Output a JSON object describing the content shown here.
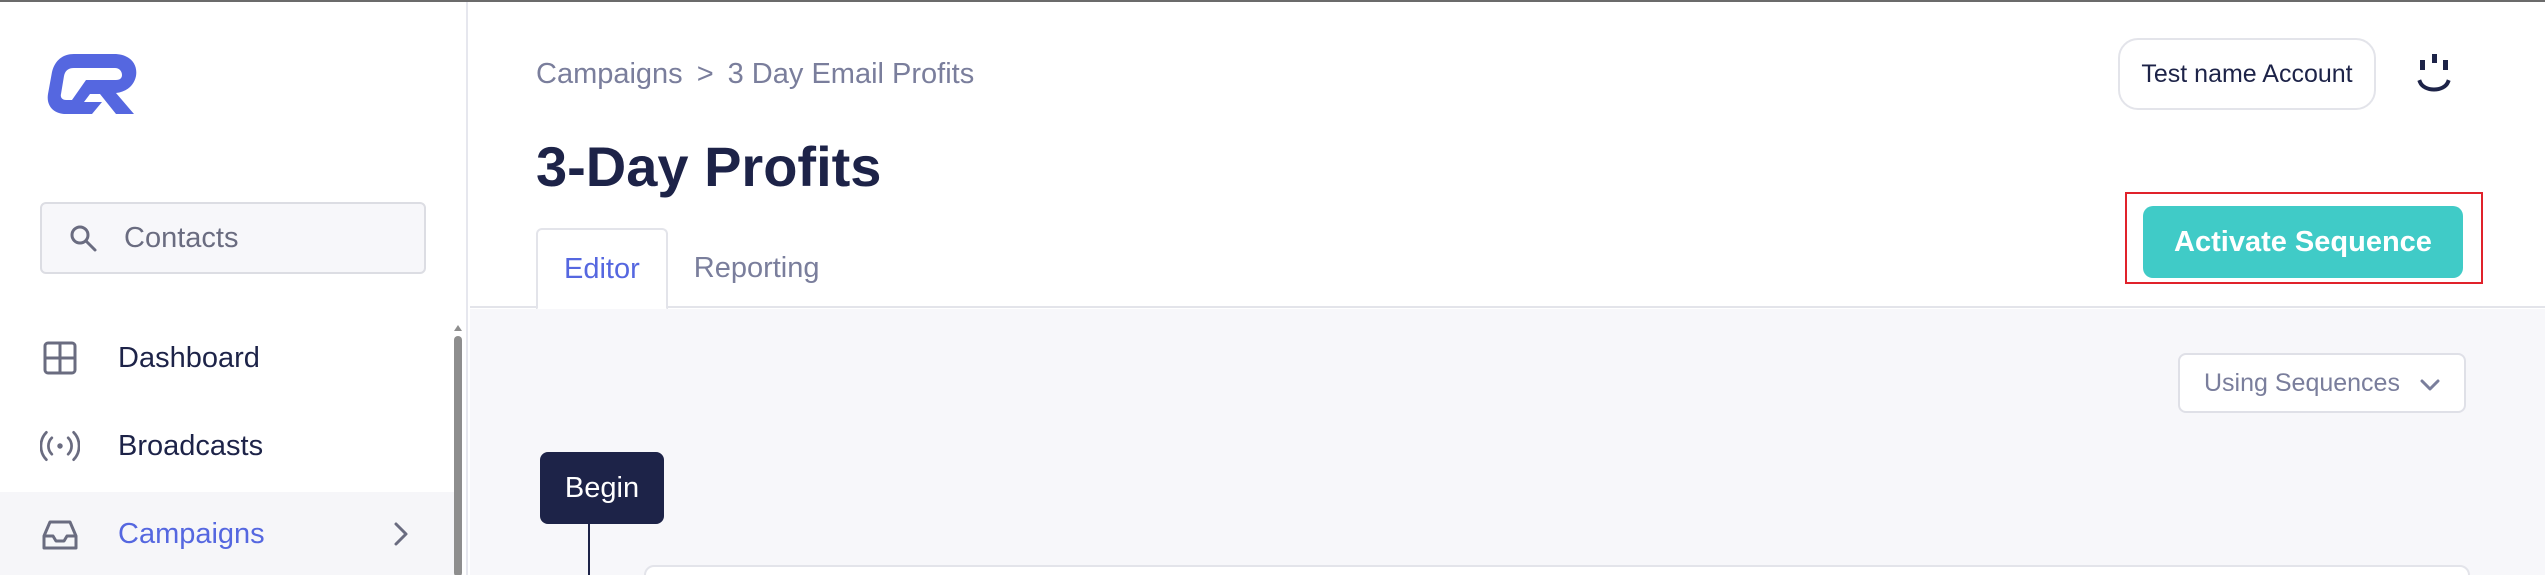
{
  "sidebar": {
    "search_label": "Contacts",
    "nav": [
      {
        "label": "Dashboard",
        "icon": "grid-icon"
      },
      {
        "label": "Broadcasts",
        "icon": "broadcast-icon"
      },
      {
        "label": "Campaigns",
        "icon": "inbox-icon",
        "active": true
      }
    ]
  },
  "header": {
    "breadcrumb": {
      "parent": "Campaigns",
      "separator": ">",
      "current": "3 Day Email Profits"
    },
    "title": "3-Day Profits",
    "tabs": [
      {
        "label": "Editor",
        "active": true
      },
      {
        "label": "Reporting"
      }
    ],
    "account_label": "Test name Account",
    "activate_label": "Activate Sequence"
  },
  "canvas": {
    "dropdown_label": "Using Sequences",
    "begin_label": "Begin"
  },
  "colors": {
    "accent": "#5567e0",
    "primary_dark": "#1d2348",
    "teal": "#40cbc7",
    "highlight_border": "#e0222b"
  }
}
